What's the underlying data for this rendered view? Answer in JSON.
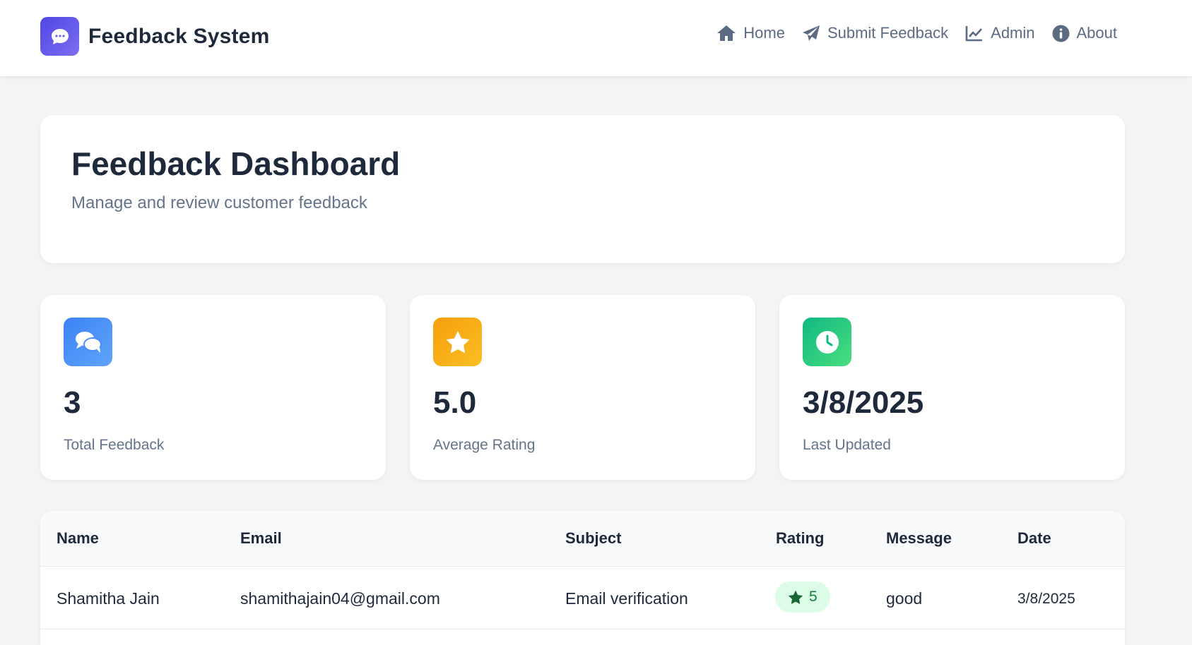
{
  "brand": {
    "title": "Feedback System",
    "logo_icon": "chat-bubble-icon",
    "color": "#4f46e5"
  },
  "nav": [
    {
      "label": "Home",
      "icon": "home-icon"
    },
    {
      "label": "Submit Feedback",
      "icon": "paper-plane-icon"
    },
    {
      "label": "Admin",
      "icon": "line-chart-icon"
    },
    {
      "label": "About",
      "icon": "info-icon"
    }
  ],
  "header": {
    "title": "Feedback Dashboard",
    "subtitle": "Manage and review customer feedback"
  },
  "stats": [
    {
      "value": "3",
      "label": "Total Feedback",
      "icon": "comments-icon",
      "color": "#3b82f6"
    },
    {
      "value": "5.0",
      "label": "Average Rating",
      "icon": "star-icon",
      "color": "#f59e0b"
    },
    {
      "value": "3/8/2025",
      "label": "Last Updated",
      "icon": "clock-icon",
      "color": "#10b981"
    }
  ],
  "table": {
    "columns": [
      "Name",
      "Email",
      "Subject",
      "Rating",
      "Message",
      "Date"
    ],
    "rows": [
      {
        "name": "Shamitha Jain",
        "email": "shamithajain04@gmail.com",
        "subject": "Email verification",
        "rating": "5",
        "message": "good",
        "date": "3/8/2025"
      }
    ]
  }
}
